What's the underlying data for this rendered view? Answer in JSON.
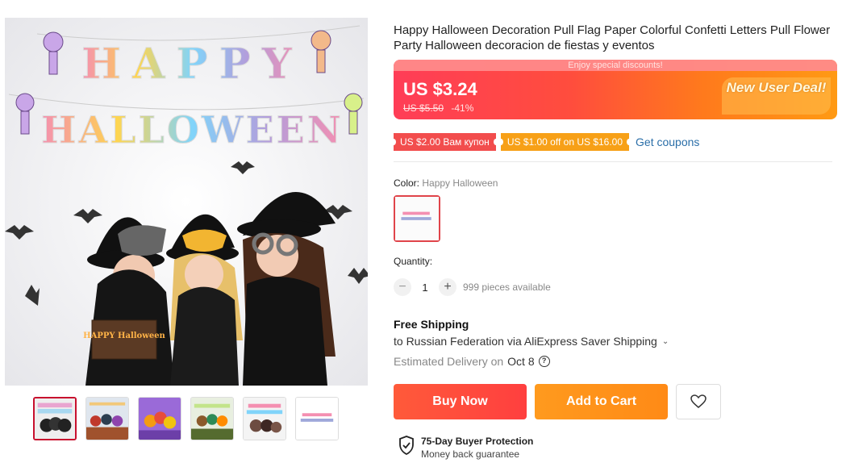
{
  "product": {
    "title": "Happy Halloween Decoration Pull Flag Paper Colorful Confetti Letters Pull Flower Party Halloween decoracion de fiestas y eventos",
    "image_banner_line1": "HAPPY",
    "image_banner_line2": "HALLOWEEN",
    "image_sign": "HAPPY Halloween"
  },
  "price": {
    "strip_text": "Enjoy special discounts!",
    "current": "US $3.24",
    "original": "US $5.50",
    "discount": "-41%",
    "badge": "New User Deal!"
  },
  "coupons": {
    "items": [
      "US $2.00 Вам купон",
      "US $1.00 off on US $16.00"
    ],
    "get_label": "Get coupons"
  },
  "color": {
    "label": "Color:",
    "value": "Happy Halloween"
  },
  "quantity": {
    "label": "Quantity:",
    "value": "1",
    "available": "999 pieces available"
  },
  "shipping": {
    "title": "Free Shipping",
    "route": "to Russian Federation via AliExpress Saver Shipping",
    "delivery_label": "Estimated Delivery on",
    "delivery_date": "Oct 8"
  },
  "actions": {
    "buy_now": "Buy Now",
    "add_to_cart": "Add to Cart"
  },
  "protection": {
    "title": "75-Day Buyer Protection",
    "subtitle": "Money back guarantee"
  },
  "thumbnails_count": 6,
  "colors": {
    "accent_red": "#ff3d57",
    "accent_orange": "#ff9a14",
    "coupon_red": "#f24d4d",
    "coupon_orange": "#f7a017",
    "link_blue": "#2a6ea8"
  }
}
